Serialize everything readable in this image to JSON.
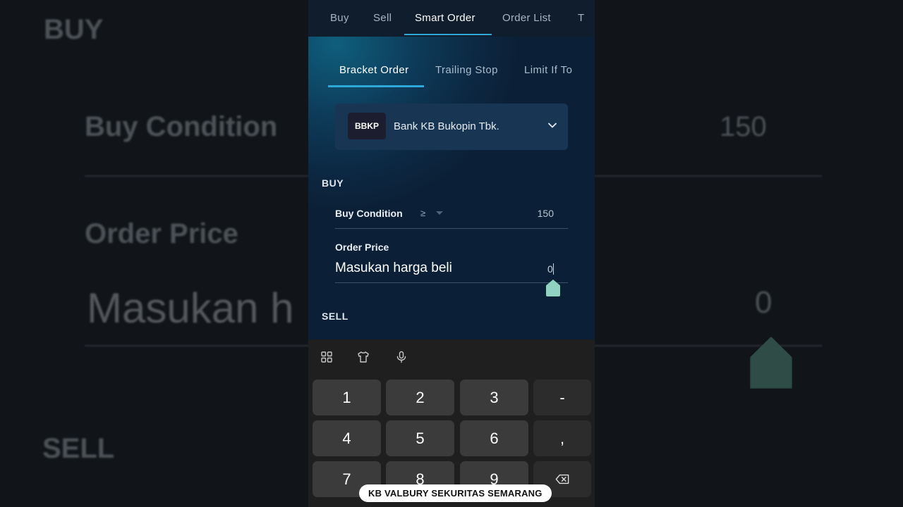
{
  "background_mirror": {
    "buy": "BUY",
    "buy_condition": "Buy Condition",
    "buy_condition_value": "150",
    "order_price": "Order Price",
    "input_partial": "Masukan h",
    "input_value": "0",
    "sell": "SELL"
  },
  "top_tabs": [
    "Buy",
    "Sell",
    "Smart Order",
    "Order List",
    "T"
  ],
  "active_top_tab": "Smart Order",
  "sub_tabs": [
    "Bracket Order",
    "Trailing Stop",
    "Limit If To"
  ],
  "active_sub_tab": "Bracket Order",
  "stock": {
    "code": "BBKP",
    "name": "Bank KB Bukopin Tbk."
  },
  "buy_section": {
    "title": "BUY",
    "condition_label": "Buy Condition",
    "condition_operator": "≥",
    "condition_value": "150",
    "order_price_label": "Order Price",
    "order_price_placeholder": "Masukan harga beli",
    "order_price_value": "0"
  },
  "sell_section": {
    "title": "SELL"
  },
  "keyboard": {
    "toolbar_icons": [
      "grid-icon",
      "shirt-icon",
      "microphone-icon"
    ],
    "keys": [
      "1",
      "2",
      "3",
      "-",
      "4",
      "5",
      "6",
      ",",
      "7",
      "8",
      "9"
    ],
    "backspace_icon": "backspace-icon"
  },
  "caption": "KB VALBURY SEKURITAS SEMARANG",
  "colors": {
    "accent": "#2ea8d8",
    "handle": "#8fd3c0",
    "panel": "#0d1a26"
  }
}
